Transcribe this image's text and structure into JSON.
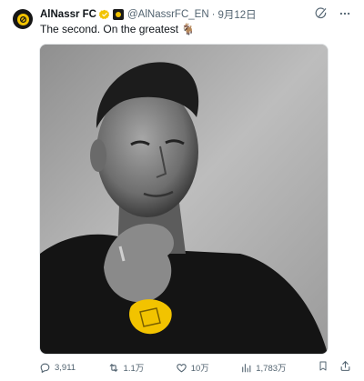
{
  "tweet": {
    "author_name": "AlNassr FC",
    "handle": "@AlNassrFC_EN",
    "separator": "·",
    "date": "9月12日",
    "text": "The second. On the greatest 🐐",
    "media_alt": "black and white portrait photo",
    "icons": {
      "avatar": "club-logo-icon",
      "verified": "verified-badge-icon",
      "affiliate": "affiliate-badge-icon",
      "grok": "grok-icon",
      "more": "more-icon"
    }
  },
  "actions": {
    "replies": "3,911",
    "retweets": "1.1万",
    "likes": "10万",
    "views": "1,783万"
  },
  "colors": {
    "accent": "#f2c300",
    "verified": "#f2c300",
    "muted_text": "#536471",
    "text": "#0f1419"
  }
}
